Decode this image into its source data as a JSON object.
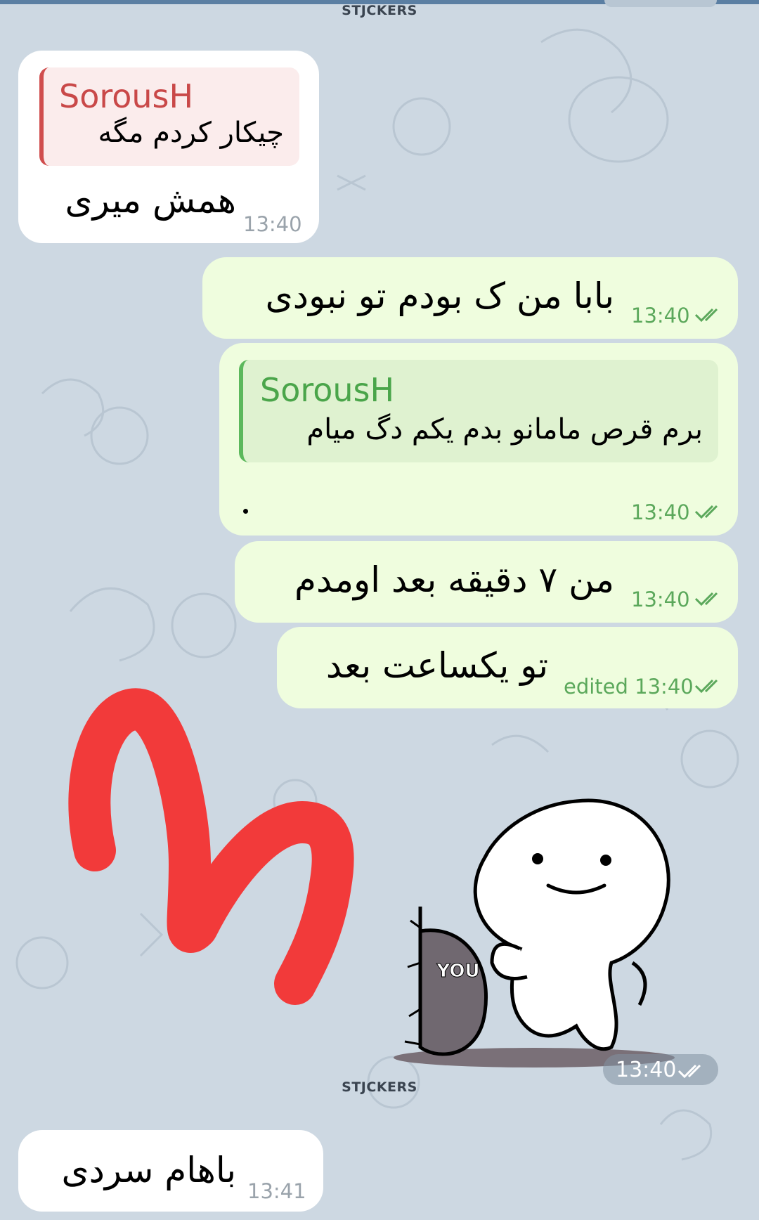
{
  "sticker_caption_top": "STJCKERS",
  "sticker_caption_bottom": "STJCKERS",
  "messages": [
    {
      "reply_name": "SorousH",
      "reply_text": "چیکار کردم مگه",
      "text": "همش میری",
      "time": "13:40"
    },
    {
      "text": "بابا من ک بودم تو نبودی",
      "time": "13:40"
    },
    {
      "reply_name": "SorousH",
      "reply_text": "برم قرص مامانو بدم یکم دگ میام",
      "text": ".",
      "time": "13:40"
    },
    {
      "text": "من ۷ دقیقه بعد اومدم",
      "time": "13:40"
    },
    {
      "text": "تو یکساعت بعد",
      "time": "edited 13:40"
    },
    {
      "sticker_text": "YOU",
      "time": "13:40"
    },
    {
      "text": "باهام سردی",
      "time": "13:41"
    }
  ],
  "colors": {
    "background": "#cdd8e2",
    "incoming_bubble": "#ffffff",
    "outgoing_bubble": "#effdde",
    "incoming_reply_accent": "#d04e4e",
    "outgoing_reply_accent": "#5cb85c",
    "scribble": "#f23a3a"
  }
}
